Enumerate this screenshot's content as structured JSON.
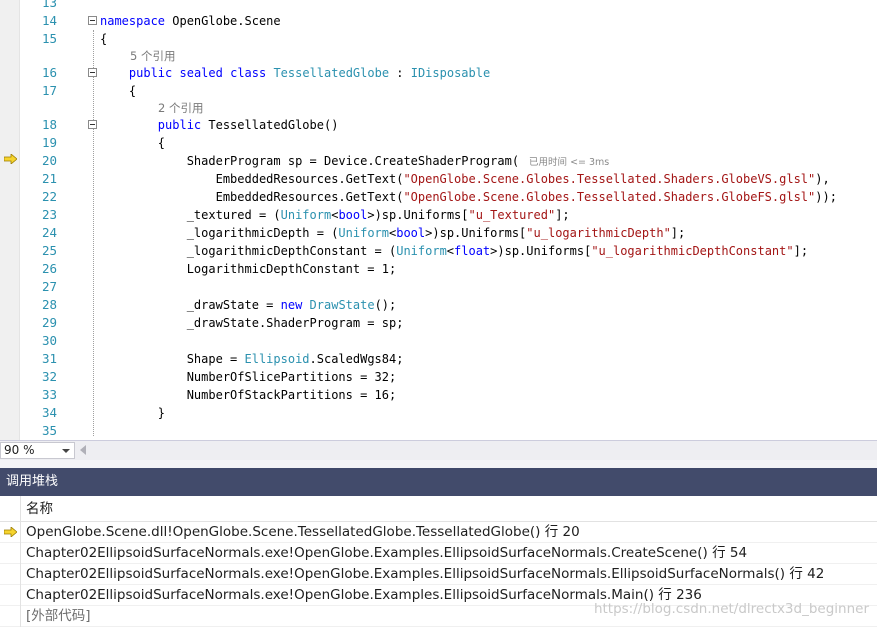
{
  "editor": {
    "zoom": "90 %",
    "lines": [
      {
        "n": "13",
        "parts": []
      },
      {
        "n": "14",
        "parts": [
          {
            "t": "namespace",
            "c": "kw"
          },
          {
            "t": " OpenGlobe.Scene",
            "c": ""
          }
        ],
        "collapse": true
      },
      {
        "n": "15",
        "parts": [
          {
            "t": "{",
            "c": ""
          }
        ]
      },
      {
        "lens": "5 个引用",
        "indent": 30
      },
      {
        "n": "16",
        "parts": [
          {
            "t": "    ",
            "c": ""
          },
          {
            "t": "public",
            "c": "kw"
          },
          {
            "t": " ",
            "c": ""
          },
          {
            "t": "sealed",
            "c": "kw"
          },
          {
            "t": " ",
            "c": ""
          },
          {
            "t": "class",
            "c": "kw"
          },
          {
            "t": " ",
            "c": ""
          },
          {
            "t": "TessellatedGlobe",
            "c": "ty"
          },
          {
            "t": " : ",
            "c": ""
          },
          {
            "t": "IDisposable",
            "c": "ty"
          }
        ],
        "collapse": true
      },
      {
        "n": "17",
        "parts": [
          {
            "t": "    {",
            "c": ""
          }
        ]
      },
      {
        "lens": "2 个引用",
        "indent": 58
      },
      {
        "n": "18",
        "parts": [
          {
            "t": "        ",
            "c": ""
          },
          {
            "t": "public",
            "c": "kw"
          },
          {
            "t": " TessellatedGlobe()",
            "c": ""
          }
        ],
        "collapse": true
      },
      {
        "n": "19",
        "parts": [
          {
            "t": "        {",
            "c": ""
          }
        ]
      },
      {
        "n": "20",
        "current": true,
        "parts": [
          {
            "t": "            ",
            "c": ""
          },
          {
            "t": "ShaderProgram",
            "c": "hl"
          },
          {
            "t": " sp = Device.CreateShaderProgram(",
            "c": "hl"
          }
        ],
        "elapsed": "已用时间 <= 3ms"
      },
      {
        "n": "21",
        "current": true,
        "parts": [
          {
            "t": "                EmbeddedResources.GetText(",
            "c": "hl"
          },
          {
            "t": "\"OpenGlobe.Scene.Globes.Tessellated.Shaders.GlobeVS.glsl\"",
            "c": "hl str"
          },
          {
            "t": "),",
            "c": "hl"
          }
        ]
      },
      {
        "n": "22",
        "current": true,
        "parts": [
          {
            "t": "                EmbeddedResources.GetText(",
            "c": "hl"
          },
          {
            "t": "\"OpenGlobe.Scene.Globes.Tessellated.Shaders.GlobeFS.glsl\"",
            "c": "hl str"
          },
          {
            "t": "));",
            "c": "hl"
          }
        ]
      },
      {
        "n": "23",
        "parts": [
          {
            "t": "            _textured = (",
            "c": ""
          },
          {
            "t": "Uniform",
            "c": "ty"
          },
          {
            "t": "<",
            "c": ""
          },
          {
            "t": "bool",
            "c": "kw"
          },
          {
            "t": ">)sp.Uniforms[",
            "c": ""
          },
          {
            "t": "\"u_Textured\"",
            "c": "str"
          },
          {
            "t": "];",
            "c": ""
          }
        ]
      },
      {
        "n": "24",
        "parts": [
          {
            "t": "            _logarithmicDepth = (",
            "c": ""
          },
          {
            "t": "Uniform",
            "c": "ty"
          },
          {
            "t": "<",
            "c": ""
          },
          {
            "t": "bool",
            "c": "kw"
          },
          {
            "t": ">)sp.Uniforms[",
            "c": ""
          },
          {
            "t": "\"u_logarithmicDepth\"",
            "c": "str"
          },
          {
            "t": "];",
            "c": ""
          }
        ]
      },
      {
        "n": "25",
        "parts": [
          {
            "t": "            _logarithmicDepthConstant = (",
            "c": ""
          },
          {
            "t": "Uniform",
            "c": "ty"
          },
          {
            "t": "<",
            "c": ""
          },
          {
            "t": "float",
            "c": "kw"
          },
          {
            "t": ">)sp.Uniforms[",
            "c": ""
          },
          {
            "t": "\"u_logarithmicDepthConstant\"",
            "c": "str"
          },
          {
            "t": "];",
            "c": ""
          }
        ]
      },
      {
        "n": "26",
        "parts": [
          {
            "t": "            LogarithmicDepthConstant = 1;",
            "c": ""
          }
        ]
      },
      {
        "n": "27",
        "parts": []
      },
      {
        "n": "28",
        "parts": [
          {
            "t": "            _drawState = ",
            "c": ""
          },
          {
            "t": "new",
            "c": "kw"
          },
          {
            "t": " ",
            "c": ""
          },
          {
            "t": "DrawState",
            "c": "ty"
          },
          {
            "t": "();",
            "c": ""
          }
        ]
      },
      {
        "n": "29",
        "parts": [
          {
            "t": "            _drawState.ShaderProgram = sp;",
            "c": ""
          }
        ]
      },
      {
        "n": "30",
        "parts": []
      },
      {
        "n": "31",
        "parts": [
          {
            "t": "            Shape = ",
            "c": ""
          },
          {
            "t": "Ellipsoid",
            "c": "ty"
          },
          {
            "t": ".ScaledWgs84;",
            "c": ""
          }
        ]
      },
      {
        "n": "32",
        "parts": [
          {
            "t": "            NumberOfSlicePartitions = 32;",
            "c": ""
          }
        ]
      },
      {
        "n": "33",
        "parts": [
          {
            "t": "            NumberOfStackPartitions = 16;",
            "c": ""
          }
        ]
      },
      {
        "n": "34",
        "parts": [
          {
            "t": "        }",
            "c": ""
          }
        ]
      },
      {
        "n": "35",
        "parts": []
      }
    ]
  },
  "callstack": {
    "title": "调用堆栈",
    "column_name": "名称",
    "rows": [
      {
        "text": "OpenGlobe.Scene.dll!OpenGlobe.Scene.TessellatedGlobe.TessellatedGlobe() 行 20",
        "current": true
      },
      {
        "text": "Chapter02EllipsoidSurfaceNormals.exe!OpenGlobe.Examples.EllipsoidSurfaceNormals.CreateScene() 行 54"
      },
      {
        "text": "Chapter02EllipsoidSurfaceNormals.exe!OpenGlobe.Examples.EllipsoidSurfaceNormals.EllipsoidSurfaceNormals() 行 42"
      },
      {
        "text": "Chapter02EllipsoidSurfaceNormals.exe!OpenGlobe.Examples.EllipsoidSurfaceNormals.Main() 行 236"
      },
      {
        "text": "[外部代码]",
        "external": true
      }
    ]
  },
  "watermark": "https://blog.csdn.net/dlrectx3d_beginner",
  "colors": {
    "highlight": "#f9ec8b",
    "keyword": "#0000ff",
    "type": "#2b91af",
    "string": "#a31515",
    "panel_title": "#424b6b"
  }
}
